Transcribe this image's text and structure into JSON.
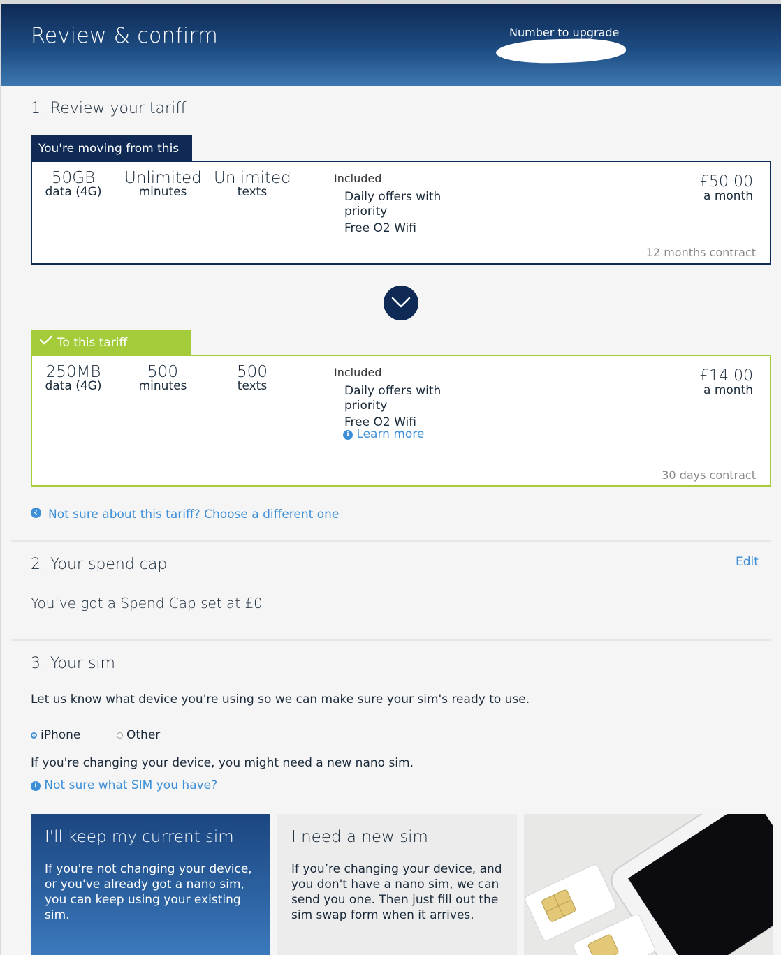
{
  "header": {
    "title": "Review & confirm",
    "number_label": "Number to upgrade"
  },
  "tariff_section": {
    "title": "1. Review your tariff",
    "from": {
      "tag": "You're moving from this",
      "data_amount": "50GB",
      "data_label": "data (4G)",
      "minutes_amount": "Unlimited",
      "minutes_label": "minutes",
      "texts_amount": "Unlimited",
      "texts_label": "texts",
      "included_label": "Included",
      "included_items": [
        "Daily offers with",
        "priority",
        "Free O2 Wifi"
      ],
      "price": "£50.00",
      "price_period": "a month",
      "contract": "12 months contract"
    },
    "to": {
      "tag": "To this tariff",
      "data_amount": "250MB",
      "data_label": "data (4G)",
      "minutes_amount": "500",
      "minutes_label": "minutes",
      "texts_amount": "500",
      "texts_label": "texts",
      "included_label": "Included",
      "included_items": [
        "Daily offers with",
        "priority",
        "Free O2 Wifi"
      ],
      "learn_more": "Learn more",
      "price": "£14.00",
      "price_period": "a month",
      "contract": "30 days contract"
    },
    "change_link": "Not sure about this tariff? Choose a different one"
  },
  "spend_cap": {
    "title": "2. Your spend cap",
    "edit": "Edit",
    "text": "You’ve got a Spend Cap set at £0"
  },
  "sim": {
    "title": "3. Your sim",
    "intro": "Let us know what device you're using so we can make sure your sim's ready to use.",
    "options": [
      "iPhone",
      "Other"
    ],
    "selected": "iPhone",
    "nano_note": "If you're changing your device, you might need a new nano sim.",
    "help_link": "Not sure what SIM you have?",
    "keep_title": "I'll keep my current sim",
    "keep_text": "If you're not changing your device, or you've already got a nano sim, you can keep using your existing sim.",
    "new_title": "I need a new sim",
    "new_text": "If you’re changing your device, and you don't have a nano sim, we can send you one. Then just fill out the sim swap form when it arrives."
  },
  "colors": {
    "navy": "#0e2a55",
    "green": "#a4cc3a",
    "link_blue": "#3d8fd8"
  }
}
